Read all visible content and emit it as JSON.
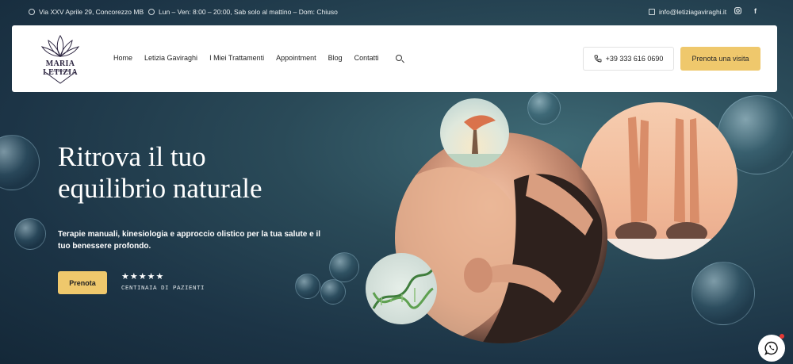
{
  "topbar": {
    "address": "Via XXV Aprile 29, Concorezzo MB",
    "hours": "Lun – Ven: 8:00 – 20:00, Sab solo al mattino – Dom: Chiuso",
    "email": "info@letiziagaviraghi.it",
    "social_instagram": "instagram-icon",
    "social_facebook": "f"
  },
  "logo": {
    "text": "MARIA LETIZIA",
    "small": "GAVIRAGHI"
  },
  "nav": {
    "items": [
      "Home",
      "Letizia Gaviraghi",
      "I Miei Trattamenti",
      "Appointment",
      "Blog",
      "Contatti"
    ]
  },
  "header": {
    "phone": "+39 333 616 0690",
    "cta": "Prenota una visita"
  },
  "hero": {
    "title_line1": "Ritrova il tuo",
    "title_line2": "equilibrio naturale",
    "subtitle": "Terapie manuali, kinesiologia e approccio olistico per la tua salute e il tuo benessere profondo.",
    "button": "Prenota",
    "stars": "★★★★★",
    "stars_label": "CENTINAIA DI PAZIENTI"
  },
  "colors": {
    "accent": "#efc86c",
    "background": "#1f3a4a"
  }
}
